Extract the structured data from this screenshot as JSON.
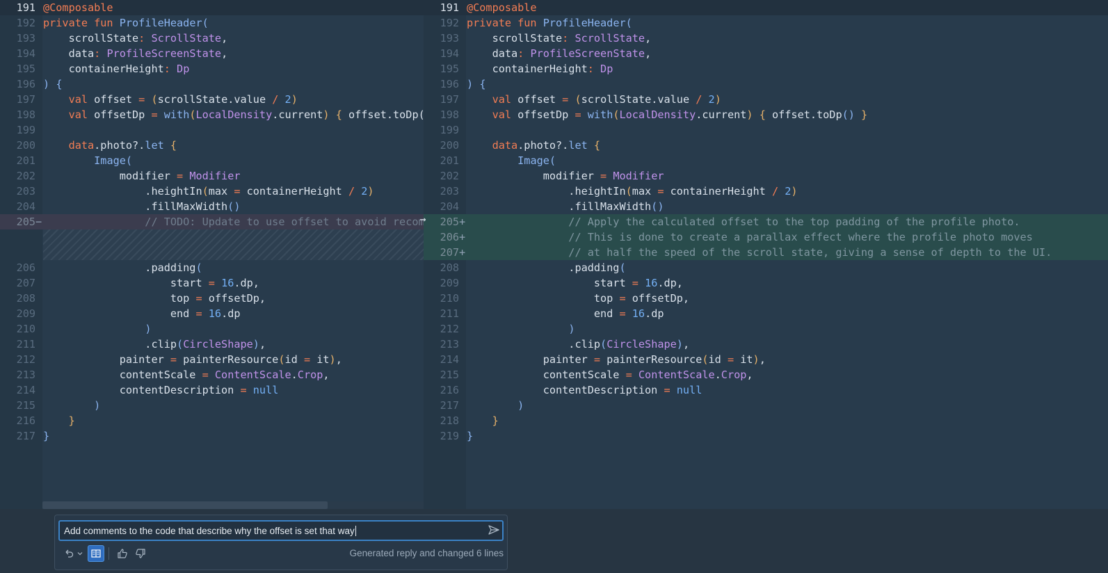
{
  "left": {
    "rows": [
      {
        "type": "first",
        "ln": "191",
        "mark": "",
        "code": "<span class=\"tk-ann\">@Composable</span>"
      },
      {
        "type": "normal",
        "ln": "192",
        "mark": "",
        "code": "<span class=\"tk-kw\">private fun</span> <span class=\"tk-fn\">ProfileHeader</span><span class=\"tk-br2\">(</span>"
      },
      {
        "type": "normal",
        "ln": "193",
        "mark": "",
        "code": "    scrollState<span class=\"tk-op\">:</span> <span class=\"tk-ty\">ScrollState</span>,"
      },
      {
        "type": "normal",
        "ln": "194",
        "mark": "",
        "code": "    data<span class=\"tk-op\">:</span> <span class=\"tk-ty\">ProfileScreenState</span>,"
      },
      {
        "type": "normal",
        "ln": "195",
        "mark": "",
        "code": "    containerHeight<span class=\"tk-op\">:</span> <span class=\"tk-ty\">Dp</span>"
      },
      {
        "type": "normal",
        "ln": "196",
        "mark": "",
        "code": "<span class=\"tk-br2\">)</span> <span class=\"tk-br2\">{</span>"
      },
      {
        "type": "normal",
        "ln": "197",
        "mark": "",
        "code": "    <span class=\"tk-kw\">val</span> offset <span class=\"tk-op\">=</span> <span class=\"tk-br\">(</span>scrollState.value <span class=\"tk-op\">/</span> <span class=\"tk-num\">2</span><span class=\"tk-br\">)</span>"
      },
      {
        "type": "normal",
        "ln": "198",
        "mark": "",
        "code": "    <span class=\"tk-kw\">val</span> offsetDp <span class=\"tk-op\">=</span> <span class=\"tk-fn\">with</span><span class=\"tk-br\">(</span><span class=\"tk-ty\">LocalDensity</span>.current<span class=\"tk-br\">)</span> <span class=\"tk-br\">{</span> offset.toDp() }"
      },
      {
        "type": "normal",
        "ln": "199",
        "mark": "",
        "code": ""
      },
      {
        "type": "normal",
        "ln": "200",
        "mark": "",
        "code": "    <span class=\"tk-kw\">data</span>.photo?.<span class=\"tk-fn\">let</span> <span class=\"tk-br\">{</span>"
      },
      {
        "type": "normal",
        "ln": "201",
        "mark": "",
        "code": "        <span class=\"tk-fn\">Image</span><span class=\"tk-br2\">(</span>"
      },
      {
        "type": "normal",
        "ln": "202",
        "mark": "",
        "code": "            modifier <span class=\"tk-op\">=</span> <span class=\"tk-ty\">Modifier</span>"
      },
      {
        "type": "normal",
        "ln": "203",
        "mark": "",
        "code": "                .heightIn<span class=\"tk-br\">(</span>max <span class=\"tk-op\">=</span> containerHeight <span class=\"tk-op\">/</span> <span class=\"tk-num\">2</span><span class=\"tk-br\">)</span>"
      },
      {
        "type": "normal",
        "ln": "204",
        "mark": "",
        "code": "                .fillMaxWidth<span class=\"tk-br2\">()</span>"
      },
      {
        "type": "removed",
        "ln": "205",
        "mark": "−",
        "code": "                // TODO: Update to use offset to avoid recomposition"
      },
      {
        "type": "hatch"
      },
      {
        "type": "skip"
      },
      {
        "type": "normal",
        "ln": "206",
        "mark": "",
        "code": "                .padding<span class=\"tk-br2\">(</span>"
      },
      {
        "type": "normal",
        "ln": "207",
        "mark": "",
        "code": "                    start <span class=\"tk-op\">=</span> <span class=\"tk-num\">16</span>.dp,"
      },
      {
        "type": "normal",
        "ln": "208",
        "mark": "",
        "code": "                    top <span class=\"tk-op\">=</span> offsetDp,"
      },
      {
        "type": "normal",
        "ln": "209",
        "mark": "",
        "code": "                    end <span class=\"tk-op\">=</span> <span class=\"tk-num\">16</span>.dp"
      },
      {
        "type": "normal",
        "ln": "210",
        "mark": "",
        "code": "                <span class=\"tk-br2\">)</span>"
      },
      {
        "type": "normal",
        "ln": "211",
        "mark": "",
        "code": "                .clip<span class=\"tk-br2\">(</span><span class=\"tk-ty\">CircleShape</span><span class=\"tk-br2\">)</span>,"
      },
      {
        "type": "normal",
        "ln": "212",
        "mark": "",
        "code": "            painter <span class=\"tk-op\">=</span> painterResource<span class=\"tk-br\">(</span>id <span class=\"tk-op\">=</span> it<span class=\"tk-br\">)</span>,"
      },
      {
        "type": "normal",
        "ln": "213",
        "mark": "",
        "code": "            contentScale <span class=\"tk-op\">=</span> <span class=\"tk-ty\">ContentScale</span>.<span class=\"tk-ty\">Crop</span>,"
      },
      {
        "type": "normal",
        "ln": "214",
        "mark": "",
        "code": "            contentDescription <span class=\"tk-op\">=</span> <span class=\"tk-lit\">null</span>"
      },
      {
        "type": "normal",
        "ln": "215",
        "mark": "",
        "code": "        <span class=\"tk-br2\">)</span>"
      },
      {
        "type": "normal",
        "ln": "216",
        "mark": "",
        "code": "    <span class=\"tk-br\">}</span>"
      },
      {
        "type": "normal",
        "ln": "217",
        "mark": "",
        "code": "<span class=\"tk-br2\">}</span>"
      }
    ]
  },
  "right": {
    "rows": [
      {
        "type": "first",
        "ln": "191",
        "mark": "",
        "code": "<span class=\"tk-ann\">@Composable</span>"
      },
      {
        "type": "normal",
        "ln": "192",
        "mark": "",
        "code": "<span class=\"tk-kw\">private fun</span> <span class=\"tk-fn\">ProfileHeader</span><span class=\"tk-br2\">(</span>"
      },
      {
        "type": "normal",
        "ln": "193",
        "mark": "",
        "code": "    scrollState<span class=\"tk-op\">:</span> <span class=\"tk-ty\">ScrollState</span>,"
      },
      {
        "type": "normal",
        "ln": "194",
        "mark": "",
        "code": "    data<span class=\"tk-op\">:</span> <span class=\"tk-ty\">ProfileScreenState</span>,"
      },
      {
        "type": "normal",
        "ln": "195",
        "mark": "",
        "code": "    containerHeight<span class=\"tk-op\">:</span> <span class=\"tk-ty\">Dp</span>"
      },
      {
        "type": "normal",
        "ln": "196",
        "mark": "",
        "code": "<span class=\"tk-br2\">)</span> <span class=\"tk-br2\">{</span>"
      },
      {
        "type": "normal",
        "ln": "197",
        "mark": "",
        "code": "    <span class=\"tk-kw\">val</span> offset <span class=\"tk-op\">=</span> <span class=\"tk-br\">(</span>scrollState.value <span class=\"tk-op\">/</span> <span class=\"tk-num\">2</span><span class=\"tk-br\">)</span>"
      },
      {
        "type": "normal",
        "ln": "198",
        "mark": "",
        "code": "    <span class=\"tk-kw\">val</span> offsetDp <span class=\"tk-op\">=</span> <span class=\"tk-fn\">with</span><span class=\"tk-br\">(</span><span class=\"tk-ty\">LocalDensity</span>.current<span class=\"tk-br\">)</span> <span class=\"tk-br\">{</span> offset.toDp<span class=\"tk-br2\">()</span> <span class=\"tk-br\">}</span>"
      },
      {
        "type": "normal",
        "ln": "199",
        "mark": "",
        "code": ""
      },
      {
        "type": "normal",
        "ln": "200",
        "mark": "",
        "code": "    <span class=\"tk-kw\">data</span>.photo?.<span class=\"tk-fn\">let</span> <span class=\"tk-br\">{</span>"
      },
      {
        "type": "normal",
        "ln": "201",
        "mark": "",
        "code": "        <span class=\"tk-fn\">Image</span><span class=\"tk-br2\">(</span>"
      },
      {
        "type": "normal",
        "ln": "202",
        "mark": "",
        "code": "            modifier <span class=\"tk-op\">=</span> <span class=\"tk-ty\">Modifier</span>"
      },
      {
        "type": "normal",
        "ln": "203",
        "mark": "",
        "code": "                .heightIn<span class=\"tk-br\">(</span>max <span class=\"tk-op\">=</span> containerHeight <span class=\"tk-op\">/</span> <span class=\"tk-num\">2</span><span class=\"tk-br\">)</span>"
      },
      {
        "type": "normal",
        "ln": "204",
        "mark": "",
        "code": "                .fillMaxWidth<span class=\"tk-br2\">()</span>"
      },
      {
        "type": "added",
        "ln": "205",
        "mark": "+",
        "code": "                // Apply the calculated offset to the top padding of the profile photo."
      },
      {
        "type": "added",
        "ln": "206",
        "mark": "+",
        "code": "                // This is done to create a parallax effect where the profile photo moves"
      },
      {
        "type": "added",
        "ln": "207",
        "mark": "+",
        "code": "                // at half the speed of the scroll state, giving a sense of depth to the UI."
      },
      {
        "type": "normal",
        "ln": "208",
        "mark": "",
        "code": "                .padding<span class=\"tk-br2\">(</span>"
      },
      {
        "type": "normal",
        "ln": "209",
        "mark": "",
        "code": "                    start <span class=\"tk-op\">=</span> <span class=\"tk-num\">16</span>.dp,"
      },
      {
        "type": "normal",
        "ln": "210",
        "mark": "",
        "code": "                    top <span class=\"tk-op\">=</span> offsetDp,"
      },
      {
        "type": "normal",
        "ln": "211",
        "mark": "",
        "code": "                    end <span class=\"tk-op\">=</span> <span class=\"tk-num\">16</span>.dp"
      },
      {
        "type": "normal",
        "ln": "212",
        "mark": "",
        "code": "                <span class=\"tk-br2\">)</span>"
      },
      {
        "type": "normal",
        "ln": "213",
        "mark": "",
        "code": "                .clip<span class=\"tk-br2\">(</span><span class=\"tk-ty\">CircleShape</span><span class=\"tk-br2\">)</span>,"
      },
      {
        "type": "normal",
        "ln": "214",
        "mark": "",
        "code": "            painter <span class=\"tk-op\">=</span> painterResource<span class=\"tk-br\">(</span>id <span class=\"tk-op\">=</span> it<span class=\"tk-br\">)</span>,"
      },
      {
        "type": "normal",
        "ln": "215",
        "mark": "",
        "code": "            contentScale <span class=\"tk-op\">=</span> <span class=\"tk-ty\">ContentScale</span>.<span class=\"tk-ty\">Crop</span>,"
      },
      {
        "type": "normal",
        "ln": "216",
        "mark": "",
        "code": "            contentDescription <span class=\"tk-op\">=</span> <span class=\"tk-lit\">null</span>"
      },
      {
        "type": "normal",
        "ln": "217",
        "mark": "",
        "code": "        <span class=\"tk-br2\">)</span>"
      },
      {
        "type": "normal",
        "ln": "218",
        "mark": "",
        "code": "    <span class=\"tk-br\">}</span>"
      },
      {
        "type": "normal",
        "ln": "219",
        "mark": "",
        "code": "<span class=\"tk-br2\">}</span>"
      }
    ]
  },
  "chat": {
    "prompt_value": "Add comments to the code that describe why the offset is set that way",
    "status": "Generated reply and changed 6 lines"
  },
  "icons": {
    "arrow": "arrow-right-icon",
    "send": "send-icon",
    "undo": "undo-icon",
    "layout": "side-by-side-icon",
    "thumbs_up": "thumbs-up-icon",
    "thumbs_down": "thumbs-down-icon"
  },
  "colors": {
    "accent": "#3b82c6",
    "added_bg": "#294c4c",
    "removed_bg": "#3b3c4e"
  }
}
